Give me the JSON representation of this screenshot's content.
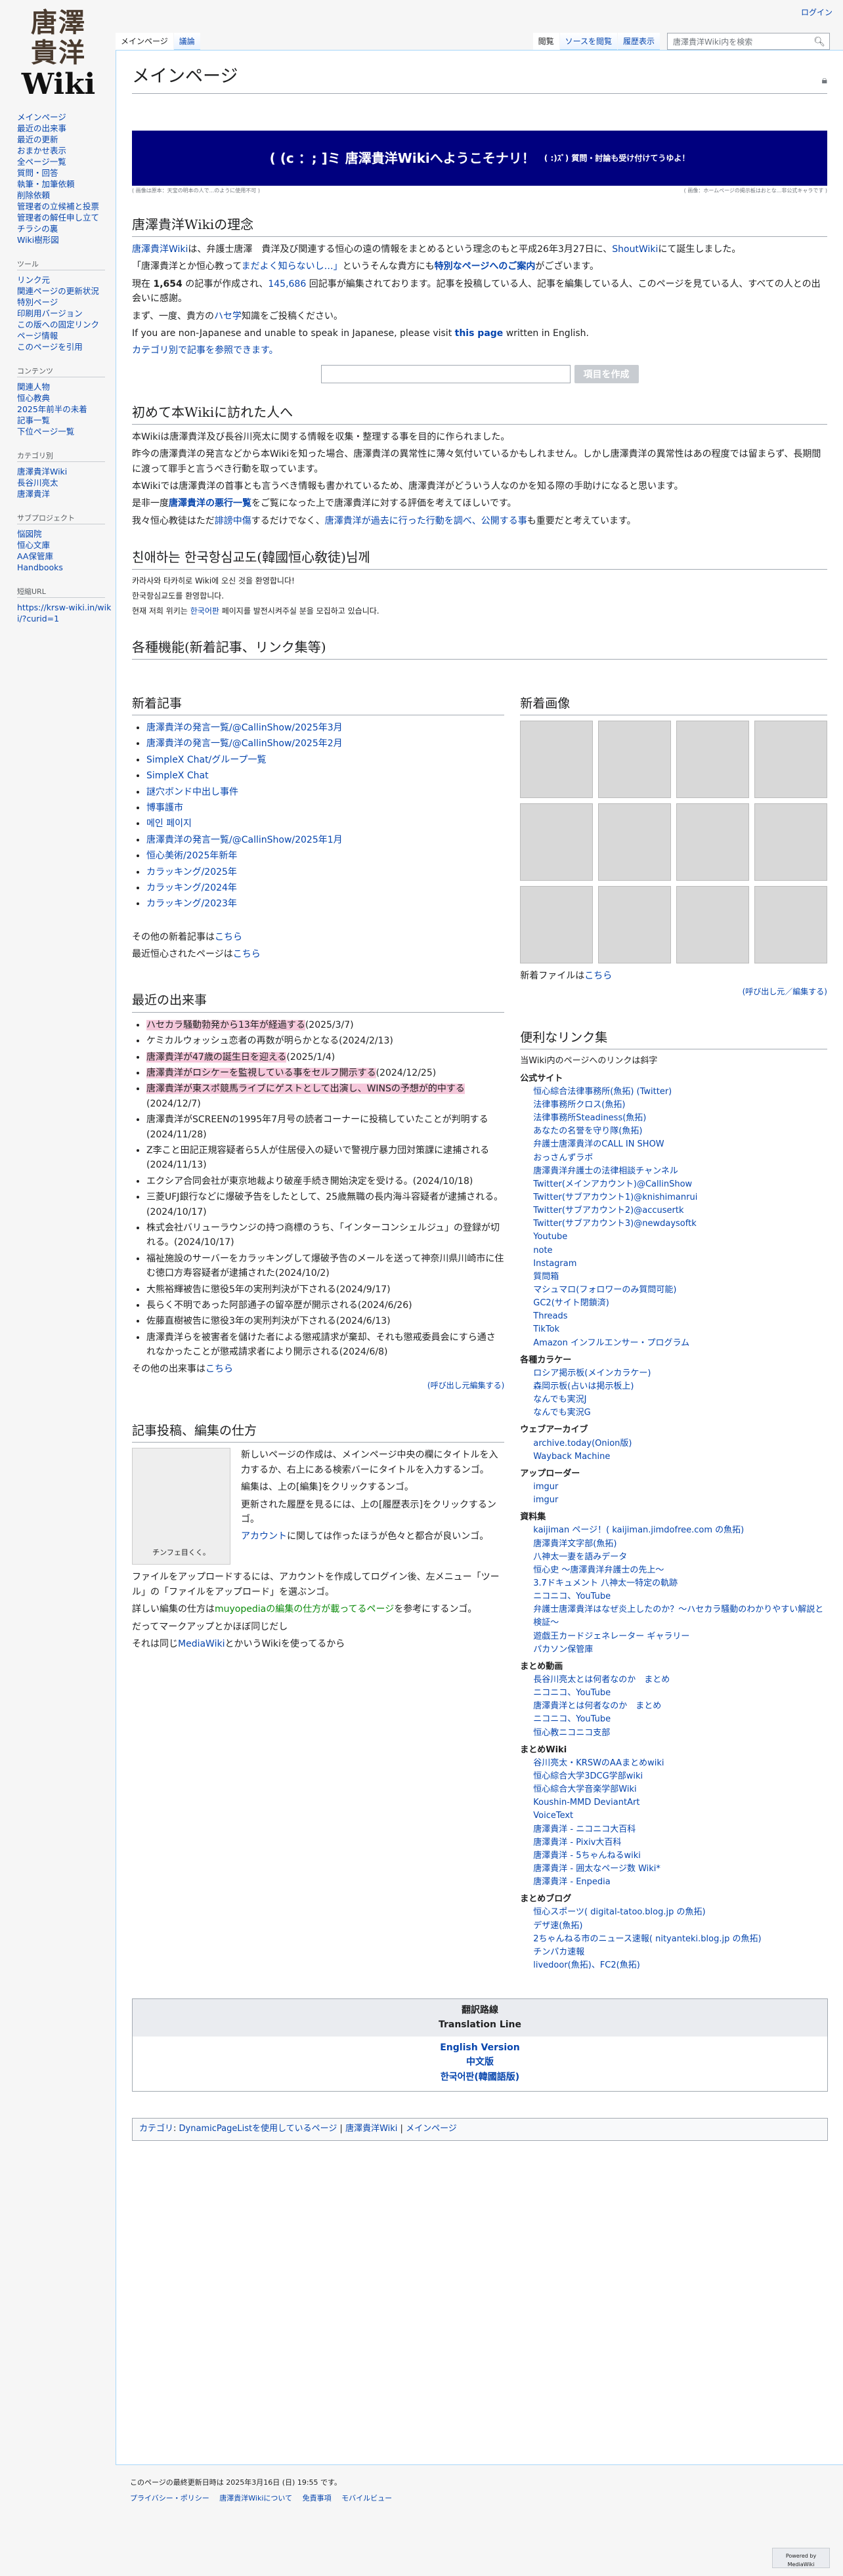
{
  "personal": {
    "login": "ログイン"
  },
  "logo": {
    "line1": "唐澤",
    "line2": "貴洋",
    "line3": "Wiki"
  },
  "tabs": {
    "main": "メインページ",
    "talk": "議論",
    "read": "閲覧",
    "source": "ソースを閲覧",
    "history": "履歴表示"
  },
  "search": {
    "placeholder": "唐澤貴洋Wiki内を検索"
  },
  "nav": [
    "メインページ",
    "最近の出来事",
    "最近の更新",
    "おまかせ表示",
    "全ページ一覧",
    "質問・回答",
    "執筆・加筆依頼",
    "削除依頼",
    "管理者の立候補と投票",
    "管理者の解任申し立て",
    "チラシの裏",
    "Wiki樹形図"
  ],
  "tools": {
    "heading": "ツール",
    "items": [
      "リンク元",
      "関連ページの更新状況",
      "特別ページ",
      "印刷用バージョン",
      "この版への固定リンク",
      "ページ情報",
      "このページを引用"
    ]
  },
  "contents": {
    "heading": "コンテンツ",
    "items": [
      "関連人物",
      "恒心教典",
      "2025年前半の未着",
      "記事一覧",
      "下位ページ一覧"
    ]
  },
  "cats": {
    "heading": "カテゴリ別",
    "items": [
      "唐澤貴洋Wiki",
      "長谷川亮太",
      "唐澤貴洋"
    ]
  },
  "apps": {
    "heading": "サブプロジェクト",
    "items": [
      "悩図院",
      "恒心文庫",
      "AA保管庫",
      "Handbooks"
    ]
  },
  "shorturl": {
    "heading": "短縮URL",
    "items": [
      "https://krsw-wiki.in/wiki/?curid=1"
    ]
  },
  "page": {
    "title": "メインページ"
  },
  "banner": {
    "main": "( (c ：; ]ミ 唐澤貴洋Wikiへようこそナリ！",
    "small": "( :)ｽﾞ) 質問・討論も受け付けてうゆよ！",
    "fine_left": "( 画像は原本：天宝の明本の人で...のように使用不可 )",
    "fine_right": "( 画像：ホームページの掲示板はおとな...非公式キャラです )"
  },
  "intro": {
    "h": "唐澤貴洋Wikiの理念",
    "p1a": "唐澤貴洋Wiki",
    "p1b": "は、弁護士唐澤　貴洋及び関連する恒心の遠の情報をまとめるという理念のもと平成26年3月27日に、",
    "p1c": "ShoutWiki",
    "p1d": "にて誕生しました。",
    "p2a": "「唐澤貴洋とか恒心教って",
    "p2b": "まだよく知らないし…」",
    "p2c": "というそんな貴方にも",
    "p2d": "特別なページへのご案内",
    "p2e": "がございます。",
    "p3a": "現在 ",
    "p3b": "1,654",
    "p3c": " の記事が作成され、",
    "p3d": "145,686",
    "p3e": " 回記事が編集されております。記事を投稿している人、記事を編集している人、このページを見ている人、すべての人との出会いに感謝。",
    "p4a": "まず、一度、貴方の",
    "p4b": "ハセ学",
    "p4c": "知識をご投稿ください。",
    "p5a": "If you are non-Japanese and unable to speak in Japanese, please visit ",
    "p5b": "this page",
    "p5c": " written in English.",
    "p6": "カテゴリ別で記事を参照できます。",
    "btn": "項目を作成"
  },
  "first": {
    "h": "初めて本Wikiに訪れた人へ",
    "p1": "本Wikiは唐澤貴洋及び長谷川亮太に関する情報を収集・整理する事を目的に作られました。",
    "p2": "昨今の唐澤貴洋の発言などから本Wikiを知った場合、唐澤貴洋の異常性に薄々気付いているかもしれません。しかし唐澤貴洋の異常性はあの程度では留まらず、長期間に渡って罪手と言うべき行動を取っています。",
    "p3": "本Wikiでは唐澤貴洋の首事とも言うべき情報も書かれているため、唐澤貴洋がどういう人なのかを知る際の手助けになると思います。",
    "p4a": "是非一度",
    "p4b": "唐澤貴洋の悪行一覧",
    "p4c": "をご覧になった上で唐澤貴洋に対する評価を考えてほしいです。",
    "p5a": "我々恒心教徒はただ",
    "p5b": "誹謗中傷",
    "p5c": "するだけでなく、",
    "p5d": "唐澤貴洋が過去に行った行動を調べ、公開する事",
    "p5e": "も重要だと考えています。"
  },
  "korea": {
    "h": "친애하는 한국항심교도(韓國恒心敎徒)님께",
    "p1": "카라사와 타카히로 Wiki에 오신 것을 환영합니다!",
    "p2": "한국항심교도를 환영합니다.",
    "p3a": "현재 저희 위키는 ",
    "p3b": "한국어판",
    "p3c": " 페이지를 발전시켜주실 분을 모집하고 있습니다."
  },
  "latest_h": "各種機能(新着記事、リンク集等)",
  "newart": {
    "h": "新着記事",
    "items": [
      "唐澤貴洋の発言一覧/@CallinShow/2025年3月",
      "唐澤貴洋の発言一覧/@CallinShow/2025年2月",
      "SimpleX Chat/グループ一覧",
      "SimpleX Chat",
      "謎穴ボンド中出し事件",
      "博事護市",
      "메인 페이지",
      "唐澤貴洋の発言一覧/@CallinShow/2025年1月",
      "恒心美術/2025年新年",
      "カラッキング/2025年",
      "カラッキング/2024年",
      "カラッキング/2023年"
    ],
    "more1a": "その他の新着記事は",
    "more1b": "こちら",
    "more2a": "最近恒心されたページは",
    "more2b": "こちら"
  },
  "events": {
    "h": "最近の出来事",
    "items": [
      {
        "t": "ハセカラ騒動勃発から13年が経過する",
        "d": "(2025/3/7)",
        "pk": true
      },
      {
        "t": "ケミカルウォッシュ恋者の再数が明らかとなる",
        "d": "(2024/2/13)",
        "pk": false
      },
      {
        "t": "唐澤貴洋が47歳の誕生日を迎える",
        "d": "(2025/1/4)",
        "pk": true
      },
      {
        "t": "唐澤貴洋がロシケーを監視している事をセルフ開示する",
        "d": "(2024/12/25)",
        "pk": true
      },
      {
        "t": "唐澤貴洋が東スポ競馬ライブにゲストとして出演し、WINSの予想が的中する",
        "d": "(2024/12/7)",
        "pk": true
      },
      {
        "t": "唐澤貴洋がSCREENの1995年7月号の読者コーナーに投稿していたことが判明する",
        "d": "(2024/11/28)",
        "pk": false
      },
      {
        "t": "Z李こと田記正規容疑者ら5人が住居侵入の疑いで警視庁暴力団対策課に逮捕される",
        "d": "(2024/11/13)",
        "pk": false
      },
      {
        "t": "エクシア合同会社が東京地裁より破産手続き開始決定を受ける。",
        "d": "(2024/10/18)",
        "pk": false
      },
      {
        "t": "三菱UFJ銀行などに爆破予告をしたとして、25歳無職の長内海斗容疑者が逮捕される。",
        "d": "(2024/10/17)",
        "pk": false
      },
      {
        "t": "株式会社バリューラウンジの持つ商標のうち、「インターコンシェルジュ」の登録が切れる。",
        "d": "(2024/10/17)",
        "pk": false
      },
      {
        "t": "福祉施設のサーバーをカラッキングして爆破予告のメールを送って神奈川県川崎市に住む徳口方寿容疑者が逮捕された",
        "d": "(2024/10/2)",
        "pk": false
      },
      {
        "t": "大熊裕輝被告に懲役5年の実刑判決が下される",
        "d": "(2024/9/17)",
        "pk": false
      },
      {
        "t": "長らく不明であった阿部通子の留卒歴が開示される",
        "d": "(2024/6/26)",
        "pk": false
      },
      {
        "t": "佐藤直樹被告に懲役3年の実刑判決が下される",
        "d": "(2024/6/13)",
        "pk": false
      },
      {
        "t": "唐澤貴洋らを被害者を儲けた者による懲戒請求が棄却、それも懲戒委員会にすら通されなかったことが懲戒請求者により開示される",
        "d": "(2024/6/8)",
        "pk": false
      }
    ],
    "morea": "その他の出来事は",
    "moreb": "こちら",
    "edit": "(呼び出し元編集する)"
  },
  "images": {
    "h": "新着画像",
    "more_a": "新着ファイルは",
    "more_b": "こちら",
    "edit": "(呼び出し元／編集する)"
  },
  "howto": {
    "h": "記事投稿、編集の仕方",
    "cap": "チンフェ目くく。",
    "p1": "新しいページの作成は、メインページ中央の欄にタイトルを入力するか、右上にある検索バーにタイトルを入力するンゴ。",
    "p2": "編集は、上の[編集]をクリックするンゴ。",
    "p3": "更新された履歴を見るには、上の[履歴表示]をクリックするンゴ。",
    "p4a": "アカウント",
    "p4b": "に関しては作ったほうが色々と都合が良いンゴ。",
    "p5": "ファイルをアップロードするには、アカウントを作成してログイン後、左メニュー「ツール」の「ファイルをアップロード」を選ぶンゴ。",
    "p6a": "詳しい編集の仕方は",
    "p6b": "muyopediaの編集の仕方が載ってるページ",
    "p6c": "を参考にするンゴ。",
    "p7": "だってマークアップとかほぼ同じだし",
    "p8a": "それは同じ",
    "p8b": "MediaWiki",
    "p8c": "とかいうWikiを使ってるから"
  },
  "links": {
    "h": "便利なリンク集",
    "intro": "当Wiki内のページへのリンクは斜字",
    "official": "公式サイト",
    "o_items": [
      "恒心綜合法律事務所(魚拓) (Twitter)",
      "法律事務所クロス(魚拓)",
      "法律事務所Steadiness(魚拓)",
      "あなたの名誉を守り隊(魚拓)",
      "弁護士唐澤貴洋のCALL IN SHOW",
      "おっさんずラボ",
      "唐澤貴洋弁護士の法律相談チャンネル",
      "Twitter(メインアカウント)@CallinShow",
      "Twitter(サブアカウント1)@knishimanrui",
      "Twitter(サブアカウント2)@accusertk",
      "Twitter(サブアカウント3)@newdaysoftk",
      "Youtube",
      "note",
      "Instagram",
      "質問箱",
      "マシュマロ(フォロワーのみ質問可能)",
      "GC2(サイト閉鎖済)",
      "Threads",
      "TikTok",
      "Amazon インフルエンサー・プログラム"
    ],
    "kara": "各種カラケー",
    "k_items": [
      "ロシア掲示板(メインカラケー)",
      "森岡示板(占いは掲示板上)",
      "なんでも実況J",
      "なんでも実況G"
    ],
    "arc": "ウェブアーカイブ",
    "a_items": [
      "archive.today(Onion版)",
      "Wayback Machine"
    ],
    "up": "アップローダー",
    "u_items": [
      "imgur",
      "imgur"
    ],
    "mat": "資料集",
    "m_items": [
      "kaijiman ページ！( kaijiman.jimdofree.com の魚拓)",
      "唐澤貴洋文字部(魚拓)",
      "八神太一妻を語みデータ",
      "恒心史 〜唐澤貴洋弁護士の先上〜",
      "3.7ドキュメント 八神太一特定の軌跡",
      "ニコニコ、YouTube",
      "弁護士唐澤貴洋はなぜ炎上したのか？〜ハセカラ騒動のわかりやすい解説と検証〜",
      "遊戯王カードジェネレーター ギャラリー",
      "パカソン保管庫"
    ],
    "movie": "まとめ動画",
    "mv1": "長谷川亮太とは何者なのか　まとめ",
    "mv2": "ニコニコ、YouTube",
    "mv3": "唐澤貴洋とは何者なのか　まとめ",
    "mv4": "ニコニコ、YouTube",
    "mv5": "恒心教ニコニコ支部",
    "mwiki": "まとめWiki",
    "w_items": [
      "谷川亮太・KRSWのAAまとめwiki",
      "恒心綜合大学3DCG学部wiki",
      "恒心綜合大学音楽学部Wiki",
      "Koushin-MMD DeviantArt",
      "VoiceText",
      "唐澤貴洋 - ニコニコ大百科",
      "唐澤貴洋 - Pixiv大百科",
      "唐澤貴洋 - 5ちゃんねるwiki",
      "唐澤貴洋 - 囲太なページ数 Wiki*",
      "唐澤貴洋 - Enpedia"
    ],
    "blog": "まとめブログ",
    "b_items": [
      "恒心スポーツ( digital-tatoo.blog.jp の魚拓)",
      "デザ速(魚拓)",
      "2ちゃんねる市のニュース速報( nityanteki.blog.jp の魚拓)",
      "チンパカ速報",
      "livedoor(魚拓)、FC2(魚拓)"
    ]
  },
  "trans": {
    "h1": "翻訳路線",
    "h2": "Translation Line",
    "l1": "English Version",
    "l2": "中文版",
    "l3": "한국어판(韓國語版)"
  },
  "catlinks": {
    "label": "カテゴリ",
    "items": [
      "DynamicPageListを使用しているページ",
      "唐澤貴洋Wiki",
      "メインページ"
    ]
  },
  "footer": {
    "lastmod": "このページの最終更新日時は 2025年3月16日 (日) 19:55 です。",
    "p1": "プライバシー・ポリシー",
    "p2": "唐澤貴洋Wikiについて",
    "p3": "免責事項",
    "p4": "モバイルビュー",
    "powered": "Powered by MediaWiki"
  }
}
